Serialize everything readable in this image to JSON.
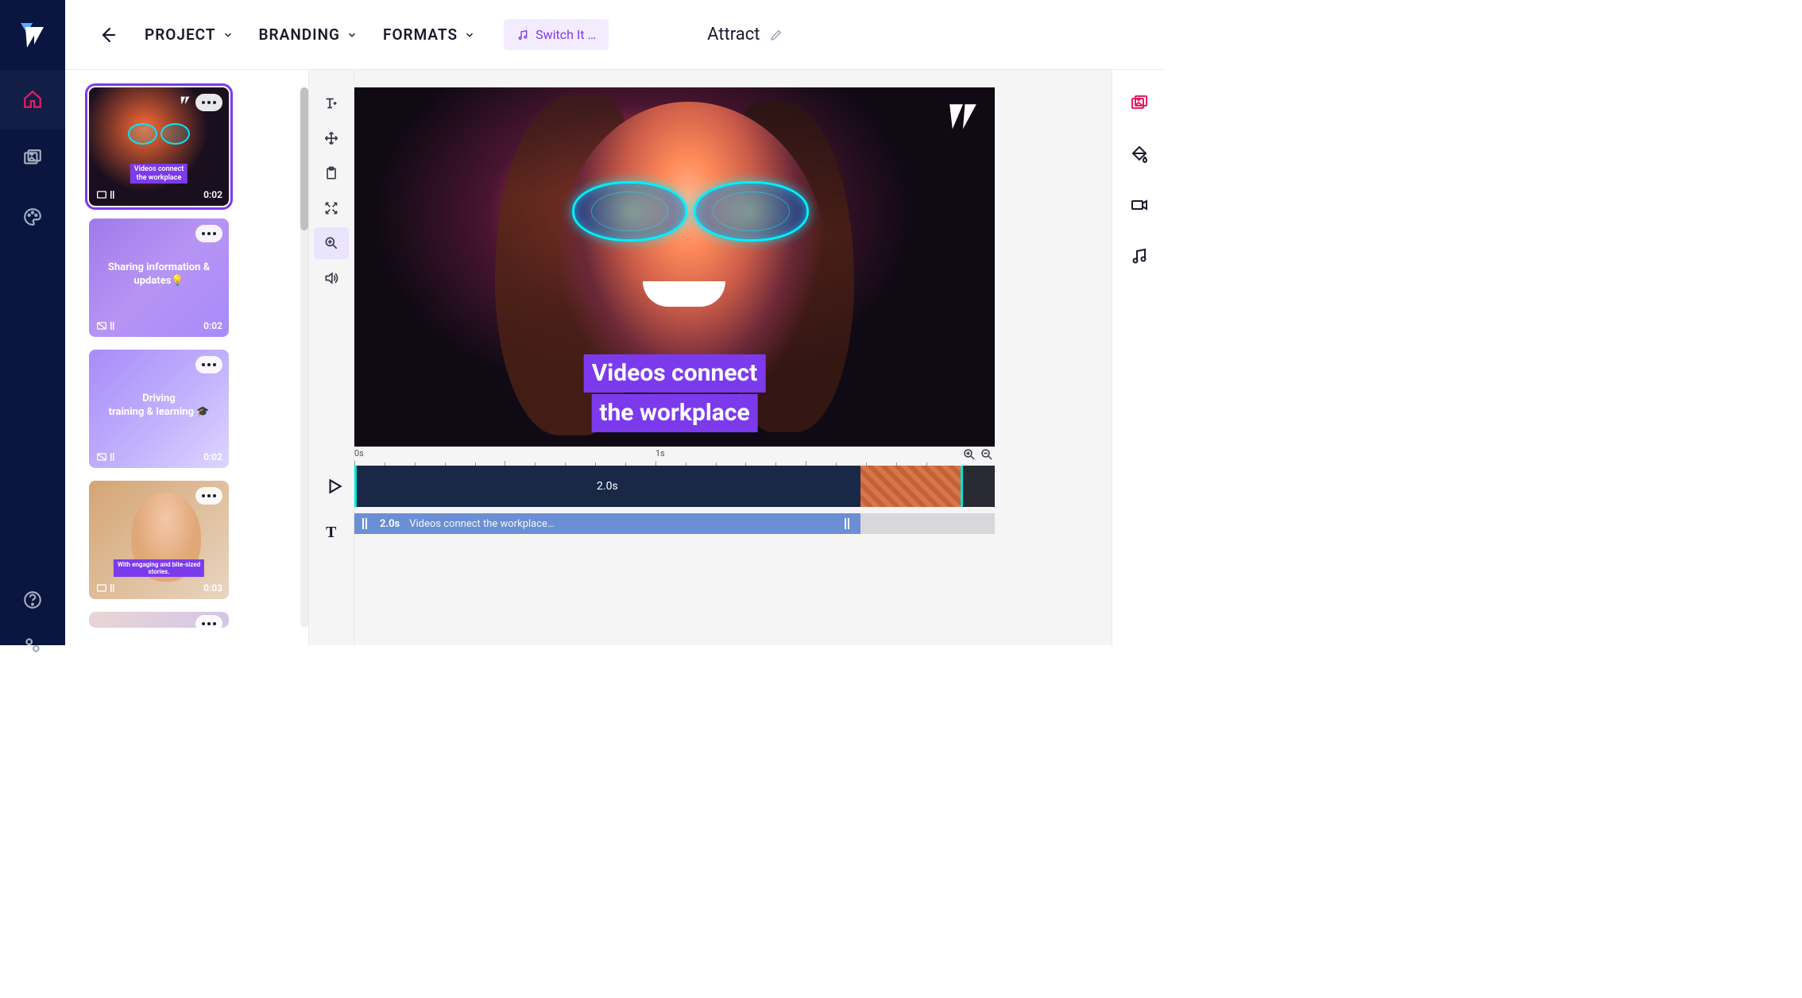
{
  "topbar": {
    "menu": [
      "PROJECT",
      "BRANDING",
      "FORMATS"
    ],
    "music_label": "Switch It …",
    "project_title": "Attract"
  },
  "scenes": [
    {
      "overlay": "Videos connect\nthe workplace",
      "duration": "0:02",
      "selected": true,
      "style": "photo"
    },
    {
      "overlay": "Sharing information & updates💡",
      "duration": "0:02",
      "selected": false,
      "style": "gradient-purple"
    },
    {
      "overlay": "Driving\ntraining & learning 🎓",
      "duration": "0:02",
      "selected": false,
      "style": "gradient-lilac"
    },
    {
      "overlay": "With engaging and bite-sized stories.",
      "duration": "0:03",
      "selected": false,
      "style": "photo-person"
    }
  ],
  "preview": {
    "text_line1": "Videos connect",
    "text_line2": "the workplace"
  },
  "timeline": {
    "marks": [
      "0s",
      "1s"
    ],
    "clip_duration": "2.0s",
    "text_track_duration": "2.0s",
    "text_track_label": "Videos connect the workplace…"
  },
  "nav_icons": [
    "home",
    "media",
    "palette"
  ],
  "tool_icons": [
    "text",
    "move",
    "clipboard",
    "expand",
    "zoom",
    "volume"
  ],
  "right_icons": [
    "image",
    "fill",
    "video",
    "music"
  ]
}
